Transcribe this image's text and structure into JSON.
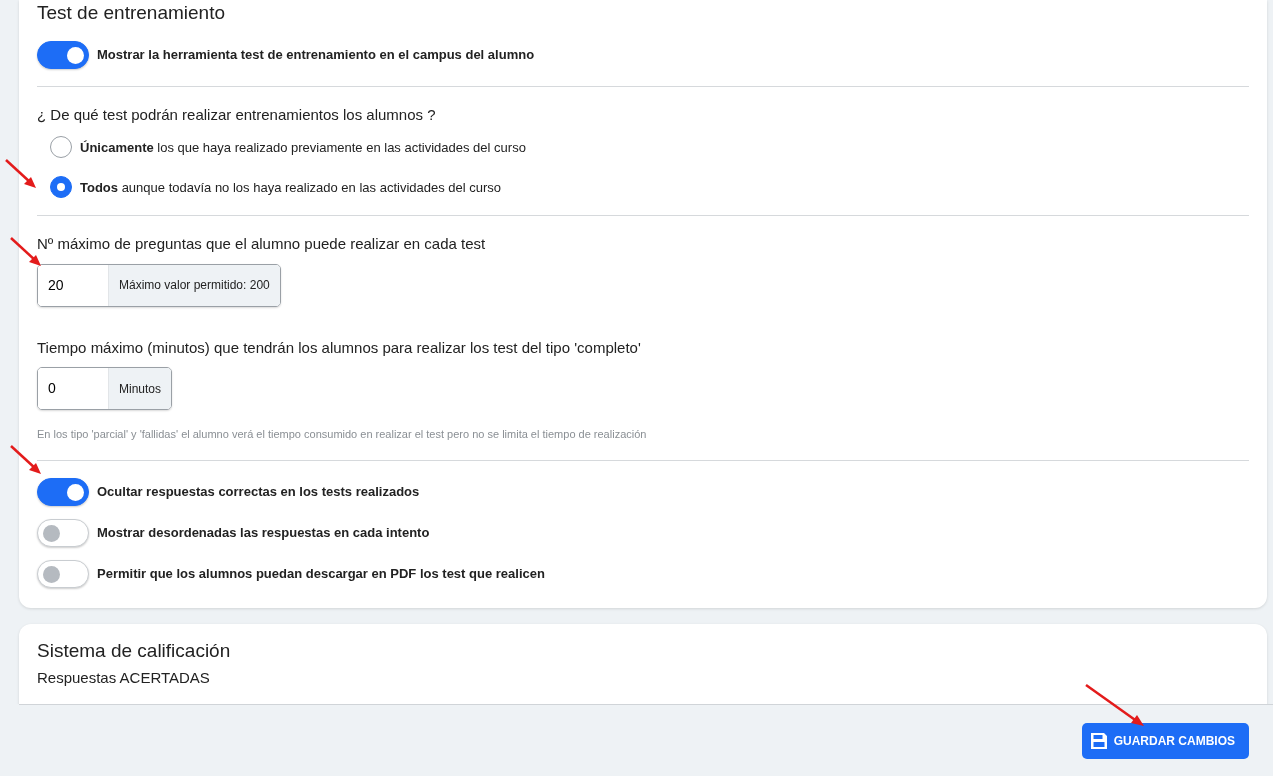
{
  "training_section": {
    "title": "Test de entrenamiento",
    "show_tool": {
      "label": "Mostrar la herramienta test de entrenamiento en el campus del alumno",
      "on": true
    }
  },
  "test_scope": {
    "question": "¿ De qué test podrán realizar entrenamientos los alumnos ?",
    "options": [
      {
        "label": "**Únicamente** los que haya realizado previamente en las actividades del curso",
        "selected": false
      },
      {
        "label": "**Todos** aunque todavía no los haya realizado en las actividades del curso",
        "selected": true,
        "arrow": true
      }
    ]
  },
  "max_questions": {
    "label": "Nº máximo de preguntas que el alumno puede realizar en cada test",
    "value": "20",
    "addon": "Máximo valor permitido: 200",
    "arrow": true
  },
  "max_time": {
    "label": "Tiempo máximo (minutos) que tendrán los alumnos para realizar los test del tipo 'completo'",
    "value": "0",
    "addon": "Minutos",
    "help": "En los tipo 'parcial' y 'fallidas' el alumno verá el tiempo consumido en realizar el test pero no se limita el tiempo de realización"
  },
  "options": [
    {
      "label": "Ocultar respuestas correctas en los tests realizados",
      "on": true,
      "arrow": true
    },
    {
      "label": "Mostrar desordenadas las respuestas en cada intento",
      "on": false
    },
    {
      "label": "Permitir que los alumnos puedan descargar en PDF los test que realicen",
      "on": false
    }
  ],
  "grading_section": {
    "title": "Sistema de calificación",
    "cut_text": "Respuestas ACERTADAS"
  },
  "footer": {
    "save_button": {
      "label": "GUARDAR CAMBIOS",
      "arrow": true
    }
  }
}
